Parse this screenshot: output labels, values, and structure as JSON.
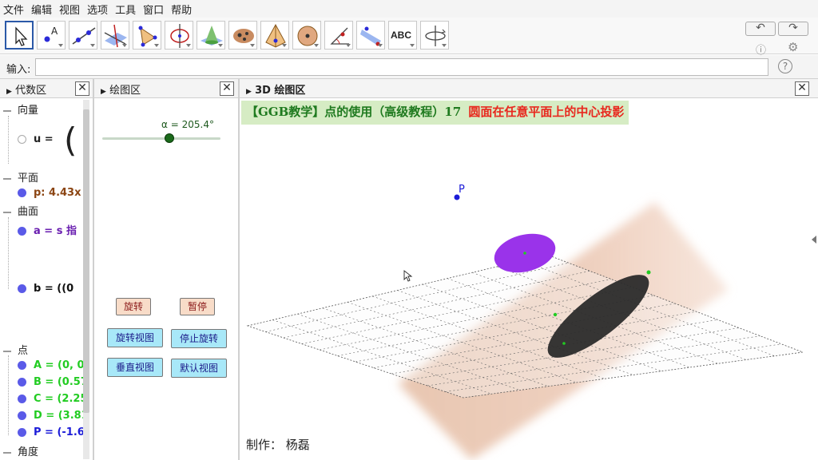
{
  "menu": [
    "文件",
    "编辑",
    "视图",
    "选项",
    "工具",
    "窗口",
    "帮助"
  ],
  "toolbar": {
    "tools": [
      "move",
      "point",
      "line",
      "perpendicular",
      "polygon",
      "circle-axis",
      "intersect-surfaces",
      "pyramid",
      "sphere",
      "angle",
      "reflect-plane",
      "text",
      "rotate-view"
    ],
    "text_tool_label": "ABC",
    "undo_label": "↶",
    "redo_label": "↷"
  },
  "input": {
    "label": "输入:",
    "value": "",
    "help": "?"
  },
  "algebra": {
    "title": "代数区",
    "categories": {
      "vector": "向量",
      "plane": "平面",
      "surface": "曲面",
      "point": "点",
      "angle": "角度"
    },
    "vector_item": "u =",
    "plane_item": "p: 4.43x",
    "surface_a": "a = s 指",
    "surface_b": "b = ((0",
    "points": [
      "A = (0, 0.",
      "B = (0.57",
      "C = (2.25",
      "D = (3.81",
      "P = (-1.6"
    ]
  },
  "graphics2d": {
    "title": "绘图区",
    "slider_label": "α = 205.4°",
    "buttons": {
      "rotate": "旋转",
      "pause": "暂停",
      "rotate_view": "旋转视图",
      "stop_rotate": "停止旋转",
      "vertical_view": "垂直视图",
      "default_view": "默认视图"
    }
  },
  "graphics3d": {
    "title": "3D 绘图区",
    "title_part1": "【GGB教学】点的使用（高级教程）17",
    "title_part2": "圆面在任意平面上的中心投影",
    "point_label": "P",
    "credit": "制作：  杨磊"
  },
  "colors": {
    "purple_disc": "#9a33ea",
    "black_disc": "#2b2b2b",
    "plane_tint": "#e8c8b8",
    "point_blue": "#1c1cd8",
    "point_green": "#22cc22",
    "title_green": "#1f7a1f",
    "title_red": "#e8281e",
    "alg_green": "#22cc22",
    "alg_brown": "#8b4513",
    "alg_purple": "#6a1fb0",
    "alg_blue": "#1c1cd8"
  }
}
